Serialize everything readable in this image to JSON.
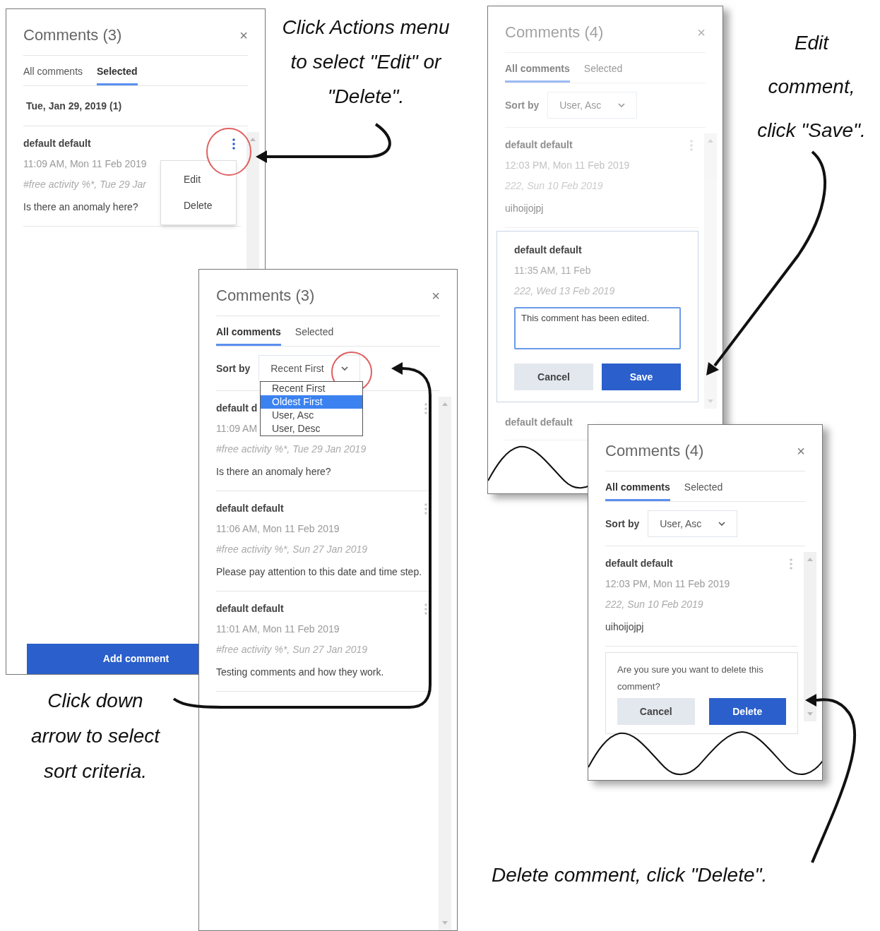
{
  "panels": [
    {
      "title": "Comments (3)",
      "close": "×",
      "dimmed": false,
      "tabs": [
        {
          "label": "All comments",
          "selected": false
        },
        {
          "label": "Selected",
          "selected": true
        }
      ],
      "date_header": "Tue, Jan 29, 2019 (1)",
      "items": [
        {
          "kind": "comment",
          "author": "default default",
          "time": "11:09 AM, Mon 11 Feb 2019",
          "activity": "#free activity %*, Tue 29 Jar",
          "text": "Is there an anomaly here?",
          "actions_active": true,
          "menu": [
            "Edit",
            "Delete"
          ]
        }
      ],
      "add_button": "Add comment"
    },
    {
      "title": "Comments (3)",
      "close": "×",
      "dimmed": false,
      "tabs": [
        {
          "label": "All comments",
          "selected": true
        },
        {
          "label": "Selected",
          "selected": false
        }
      ],
      "sort": {
        "label": "Sort by",
        "value": "Recent First",
        "options": [
          {
            "label": "Recent First",
            "highlighted": false
          },
          {
            "label": "Oldest First",
            "highlighted": true
          },
          {
            "label": "User, Asc",
            "highlighted": false
          },
          {
            "label": "User, Desc",
            "highlighted": false
          }
        ]
      },
      "items": [
        {
          "kind": "comment",
          "author": "default d",
          "time": "11:09 AM",
          "activity": "#free activity %*, Tue 29 Jan 2019",
          "text": "Is there an anomaly here?",
          "actions_active": false
        },
        {
          "kind": "comment",
          "author": "default default",
          "time": "11:06 AM, Mon 11 Feb 2019",
          "activity": "#free activity %*, Sun 27 Jan 2019",
          "text": "Please pay attention to this date and time step.",
          "actions_active": false
        },
        {
          "kind": "comment",
          "author": "default default",
          "time": "11:01 AM, Mon 11 Feb 2019",
          "activity": "#free activity %*, Sun 27 Jan 2019",
          "text": "Testing comments and how they work.",
          "actions_active": false
        }
      ]
    },
    {
      "title": "Comments (4)",
      "close": "×",
      "dimmed": true,
      "tabs": [
        {
          "label": "All comments",
          "selected": true
        },
        {
          "label": "Selected",
          "selected": false
        }
      ],
      "sort": {
        "label": "Sort by",
        "value": "User, Asc"
      },
      "items": [
        {
          "kind": "comment",
          "author": "default default",
          "time": "12:03 PM, Mon 11 Feb 2019",
          "activity": "222, Sun 10 Feb 2019",
          "text": "uihoijojpj",
          "actions_active": false
        },
        {
          "kind": "edit",
          "author": "default default",
          "time": "11:35 AM, 11 Feb",
          "activity": "222, Wed 13 Feb 2019",
          "value": "This comment has been edited.",
          "buttons": [
            "Cancel",
            "Save"
          ]
        },
        {
          "kind": "comment",
          "author": "default default"
        }
      ]
    },
    {
      "title": "Comments (4)",
      "close": "×",
      "dimmed": false,
      "tabs": [
        {
          "label": "All comments",
          "selected": true
        },
        {
          "label": "Selected",
          "selected": false
        }
      ],
      "sort": {
        "label": "Sort by",
        "value": "User, Asc"
      },
      "items": [
        {
          "kind": "comment",
          "author": "default default",
          "time": "12:03 PM, Mon 11 Feb 2019",
          "activity": "222, Sun 10 Feb 2019",
          "text": "uihoijojpj",
          "actions_active": false
        },
        {
          "kind": "confirm",
          "message": "Are you sure you want to delete this comment?",
          "buttons": [
            "Cancel",
            "Delete"
          ]
        }
      ]
    }
  ],
  "annotations": [
    {
      "lines": [
        "Click Actions menu",
        "to select \"Edit\" or",
        "\"Delete\"."
      ]
    },
    {
      "lines": [
        "Edit",
        "comment,",
        "click \"Save\"."
      ]
    },
    {
      "lines": [
        "Click down",
        "arrow to select",
        "sort criteria."
      ]
    },
    {
      "lines": [
        "Delete comment, click \"Delete\"."
      ]
    }
  ]
}
